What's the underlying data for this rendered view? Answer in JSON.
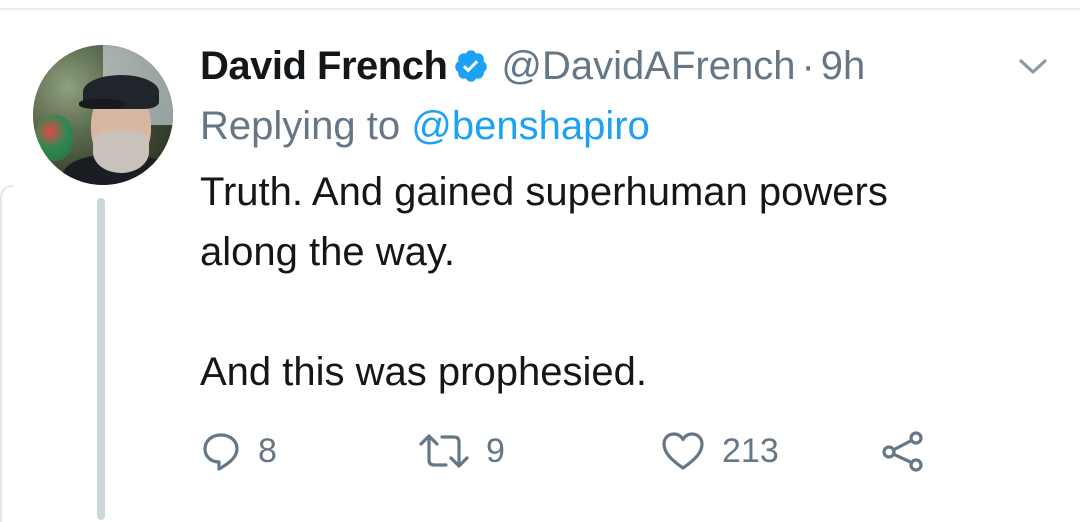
{
  "tweet": {
    "author_name": "David French",
    "verified": true,
    "handle": "@DavidAFrench",
    "separator": "·",
    "time": "9h",
    "replying_prefix": "Replying to",
    "replying_to": "@benshapiro",
    "text_lines": [
      "Truth. And gained superhuman powers",
      "along the way.",
      "",
      "And this was prophesied."
    ],
    "reply_count": "8",
    "retweet_count": "9",
    "like_count": "213"
  },
  "colors": {
    "verified_blue": "#1da1f2",
    "secondary_text": "#657786",
    "primary_text": "#14171a",
    "thread_line": "#ccd6dd"
  },
  "icons": [
    "verified-badge-icon",
    "chevron-down-icon",
    "reply-icon",
    "retweet-icon",
    "like-icon",
    "share-icon"
  ]
}
